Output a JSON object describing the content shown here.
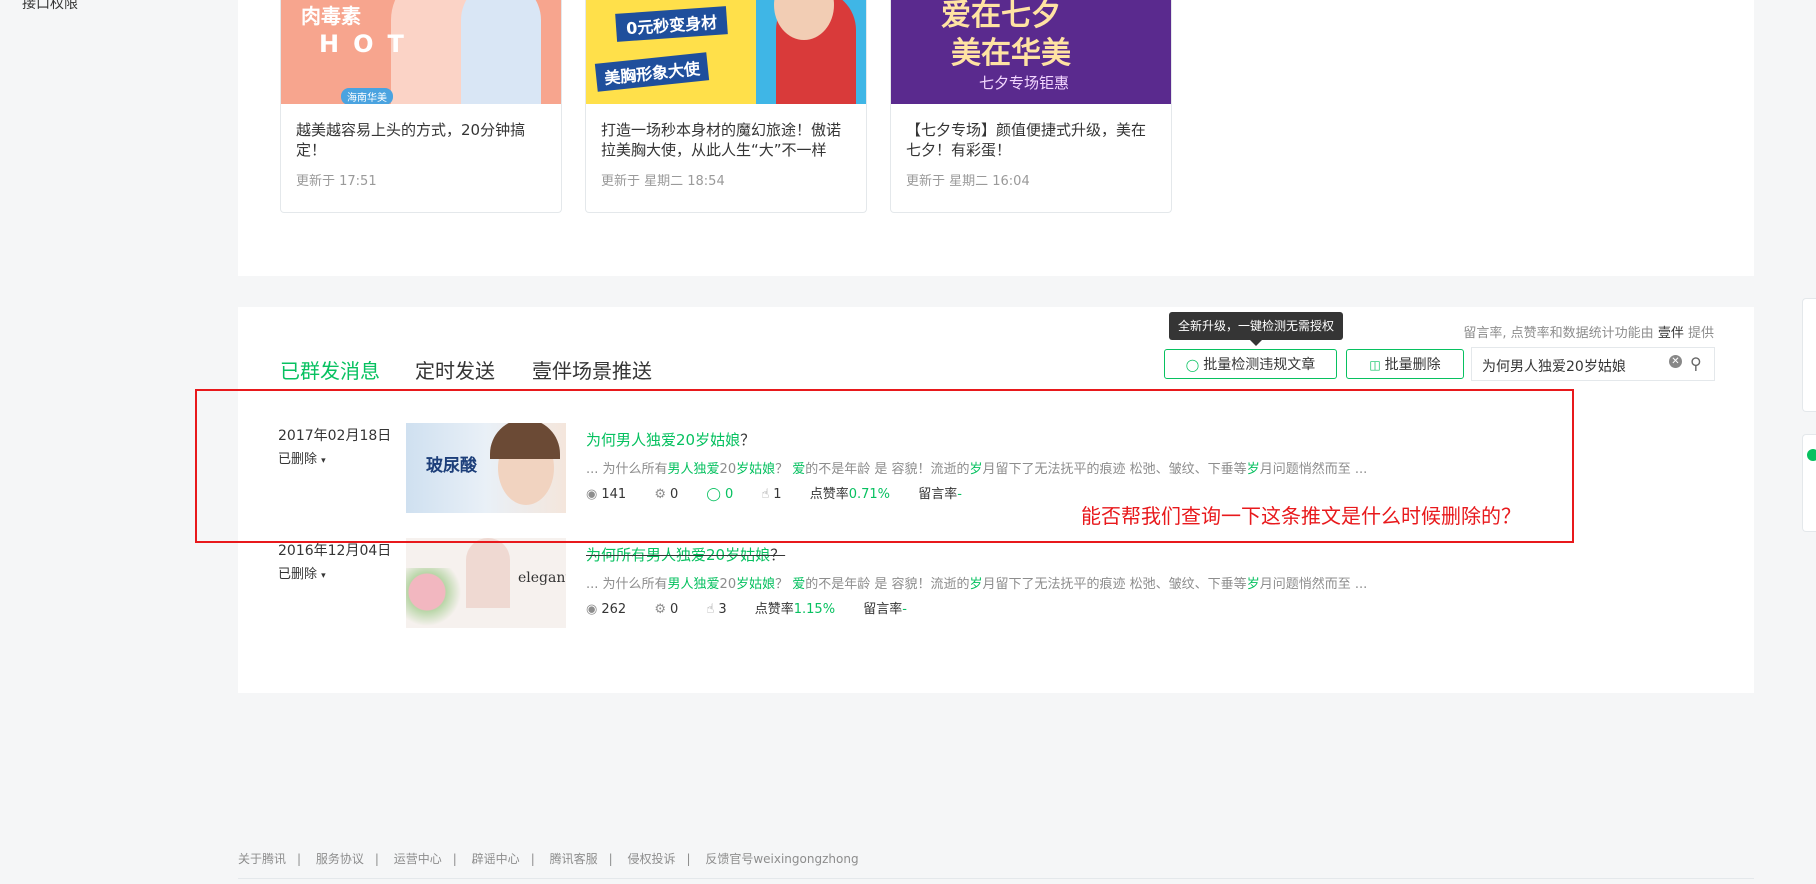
{
  "sidebar": {
    "partial_label": "接口权限"
  },
  "cards": [
    {
      "title": "越美越容易上头的方式，20分钟搞定！",
      "updated": "更新于 17:51",
      "image_text": {
        "line1": "肉毒素",
        "line2": "HOT",
        "badge": "海南华美"
      }
    },
    {
      "title": "打造一场秒本身材的魔幻旅途！傲诺拉美胸大使，从此人生“大”不一样",
      "updated": "更新于 星期二 18:54",
      "image_text": {
        "line1": "0元秒变身材",
        "line2": "美胸形象大使"
      }
    },
    {
      "title": "【七夕专场】颜值便捷式升级，美在七夕！有彩蛋！",
      "updated": "更新于 星期二 16:04",
      "image_text": {
        "line1": "爱在七夕",
        "line2": "美在华美",
        "line3": "七夕专场钜惠"
      }
    }
  ],
  "tabs": [
    {
      "label": "已群发消息",
      "active": true
    },
    {
      "label": "定时发送",
      "active": false
    },
    {
      "label": "壹伴场景推送",
      "active": false
    }
  ],
  "notice": {
    "prefix": "留言率, 点赞率和数据统计功能由",
    "brand": "壹伴",
    "suffix": "提供"
  },
  "tooltip": "全新升级，一键检测无需授权",
  "toolbar": {
    "check_label": "批量检测违规文章",
    "delete_label": "批量删除"
  },
  "search": {
    "value": "为何男人独爱20岁姑娘"
  },
  "messages": [
    {
      "date": "2017年02月18日",
      "status": "已删除",
      "image_text": "玻尿酸",
      "title_parts": [
        "为何男人独爱20岁姑娘",
        "？"
      ],
      "digest_parts": [
        "... 为什么所有",
        "男人独爱",
        "20",
        "岁姑娘",
        "？ ",
        "爱",
        "的不是年龄 是 容貌！流逝的",
        "岁",
        "月留下了无法抚平的痕迹 松弛、皱纹、下垂等",
        "岁",
        "月问题悄然而至 ..."
      ],
      "views": "141",
      "shares": "0",
      "comments": "0",
      "likes": "1",
      "like_rate_label": "点赞率",
      "like_rate": "0.71%",
      "comment_rate_label": "留言率",
      "comment_rate": "-"
    },
    {
      "date": "2016年12月04日",
      "status": "已删除",
      "image_text": "elegant",
      "title_parts": [
        "为何所有",
        "男人独爱20岁姑娘",
        "？"
      ],
      "digest_parts": [
        "... 为什么所有",
        "男人独爱",
        "20",
        "岁姑娘",
        "？ ",
        "爱",
        "的不是年龄 是 容貌！流逝的",
        "岁",
        "月留下了无法抚平的痕迹 松弛、皱纹、下垂等",
        "岁",
        "月问题悄然而至 ..."
      ],
      "views": "262",
      "shares": "0",
      "likes": "3",
      "like_rate_label": "点赞率",
      "like_rate": "1.15%",
      "comment_rate_label": "留言率",
      "comment_rate": "-"
    }
  ],
  "annotation": "能否帮我们查询一下这条推文是什么时候删除的？",
  "footer": [
    "关于腾讯",
    "服务协议",
    "运营中心",
    "辟谣中心",
    "腾讯客服",
    "侵权投诉",
    "反馈官号weixingongzhong"
  ],
  "colors": {
    "accent": "#07c160",
    "annotation": "#e8191c"
  }
}
